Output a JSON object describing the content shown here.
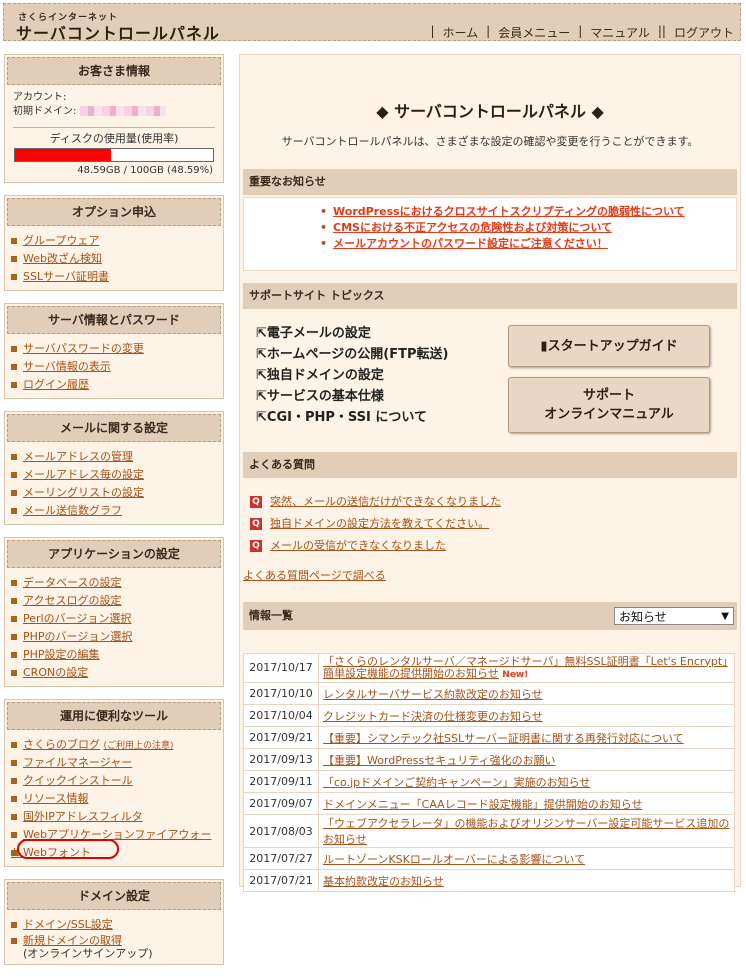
{
  "header": {
    "brand_small": "さくらインターネット",
    "brand_big": "サーバコントロールパネル",
    "nav": [
      "ホーム",
      "会員メニュー",
      "マニュアル",
      "ログアウト"
    ]
  },
  "sidebar": {
    "customer": {
      "title": "お客さま情報",
      "account_label": "アカウント:",
      "domain_label": "初期ドメイン:",
      "disk_label": "ディスクの使用量(使用率)",
      "disk_fraction": 0.4859,
      "disk_text": "48.59GB / 100GB (48.59%)"
    },
    "options": {
      "title": "オプション申込",
      "items": [
        "グループウェア",
        "Web改ざん検知",
        "SSLサーバ証明書"
      ]
    },
    "server": {
      "title": "サーバ情報とパスワード",
      "items": [
        "サーバパスワードの変更",
        "サーバ情報の表示",
        "ログイン履歴"
      ]
    },
    "mail": {
      "title": "メールに関する設定",
      "items": [
        "メールアドレスの管理",
        "メールアドレス毎の設定",
        "メーリングリストの設定",
        "メール送信数グラフ"
      ]
    },
    "app": {
      "title": "アプリケーションの設定",
      "items": [
        "データベースの設定",
        "アクセスログの設定",
        "Perlのバージョン選択",
        "PHPのバージョン選択",
        "PHP設定の編集",
        "CRONの設定"
      ]
    },
    "tools": {
      "title": "運用に便利なツール",
      "items": [
        "さくらのブログ",
        "ファイルマネージャー",
        "クイックインストール",
        "リソース情報",
        "国外IPアドレスフィルタ",
        "Webアプリケーションファイアウォール",
        "Webフォント"
      ],
      "blog_note": "(ご利用上の注意)"
    },
    "domain": {
      "title": "ドメイン設定",
      "items": [
        "ドメイン/SSL設定",
        "新規ドメインの取得"
      ],
      "acquire_note": "(オンラインサインアップ)"
    }
  },
  "main": {
    "title": "◆ サーバコントロールパネル ◆",
    "subtitle": "サーバコントロールパネルは、さまざまな設定の確認や変更を行うことができます。",
    "notice": {
      "title": "重要なお知らせ",
      "items": [
        "WordPressにおけるクロスサイトスクリプティングの脆弱性について",
        "CMSにおける不正アクセスの危険性および対策について",
        "メールアカウントのパスワード設定にご注意ください！"
      ]
    },
    "support": {
      "title": "サポートサイト トピックス",
      "topics": [
        "電子メールの設定",
        "ホームページの公開(FTP転送)",
        "独自ドメインの設定",
        "サービスの基本仕様",
        "CGI・PHP・SSI について"
      ],
      "startup_button": "スタートアップガイド",
      "manual_button_1": "サポート",
      "manual_button_2": "オンラインマニュアル"
    },
    "faq": {
      "title": "よくある質問",
      "items": [
        "突然、メールの送信だけができなくなりました",
        "独自ドメインの設定方法を教えてください。",
        "メールの受信ができなくなりました"
      ],
      "link": "よくある質問ページで調べる"
    },
    "info": {
      "title": "情報一覧",
      "select_value": "お知らせ",
      "new_badge": "New!",
      "rows": [
        {
          "date": "2017/10/17",
          "text": "「さくらのレンタルサーバ／マネージドサーバ」無料SSL証明書「Let's Encrypt」簡単設定機能の提供開始のお知らせ"
        },
        {
          "date": "2017/10/10",
          "text": "レンタルサーバサービス約款改定のお知らせ"
        },
        {
          "date": "2017/10/04",
          "text": "クレジットカード決済の仕様変更のお知らせ"
        },
        {
          "date": "2017/09/21",
          "text": "【重要】シマンテック社SSLサーバー証明書に関する再発行対応について"
        },
        {
          "date": "2017/09/13",
          "text": "【重要】WordPressセキュリティ強化のお願い"
        },
        {
          "date": "2017/09/11",
          "text": "「co.jpドメインご契約キャンペーン」実施のお知らせ"
        },
        {
          "date": "2017/09/07",
          "text": "ドメインメニュー「CAAレコード設定機能」提供開始のお知らせ"
        },
        {
          "date": "2017/08/03",
          "text": "「ウェブアクセラレータ」の機能およびオリジンサーバー設定可能サービス追加のお知らせ"
        },
        {
          "date": "2017/07/27",
          "text": "ルートゾーンKSKロールオーバーによる影響について"
        },
        {
          "date": "2017/07/21",
          "text": "基本約款改定のお知らせ"
        }
      ]
    }
  }
}
